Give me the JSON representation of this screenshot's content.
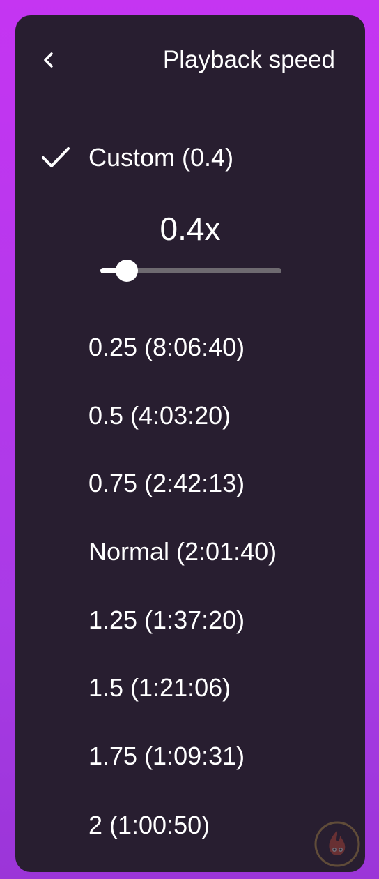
{
  "header": {
    "title": "Playback speed",
    "back_icon": "chevron-left-icon"
  },
  "custom": {
    "label": "Custom (0.4)",
    "selected": true,
    "check_icon": "checkmark-icon",
    "value_display": "0.4x",
    "slider_value": 0.4,
    "slider_min": 0.25,
    "slider_max": 2
  },
  "options": [
    {
      "label": "0.25 (8:06:40)"
    },
    {
      "label": "0.5 (4:03:20)"
    },
    {
      "label": "0.75 (2:42:13)"
    },
    {
      "label": "Normal (2:01:40)"
    },
    {
      "label": "1.25 (1:37:20)"
    },
    {
      "label": "1.5 (1:21:06)"
    },
    {
      "label": "1.75 (1:09:31)"
    },
    {
      "label": "2 (1:00:50)"
    }
  ],
  "colors": {
    "panel_background": "#281e30",
    "page_background": "#c535f2",
    "text": "#ffffff",
    "slider_track": "#6e6a70",
    "divider": "#5a5060"
  }
}
